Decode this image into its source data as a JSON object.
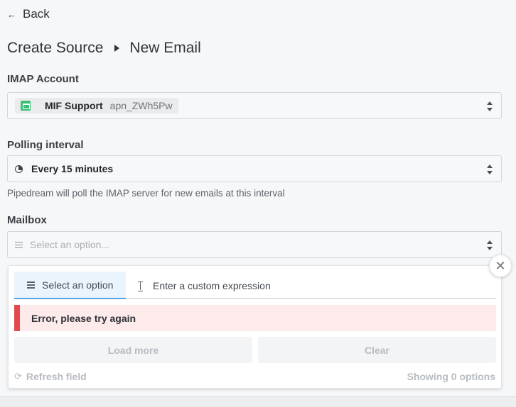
{
  "nav": {
    "back_arrow": "←",
    "back_label": "Back"
  },
  "header": {
    "crumb_1": "Create Source",
    "crumb_2": "New Email",
    "separator_icon": "caret-right-icon"
  },
  "imap": {
    "label": "IMAP Account",
    "account_icon": "email-icon",
    "account_icon_color": "#3bbf76",
    "account_name": "MIF Support",
    "account_id": "apn_ZWh5Pw"
  },
  "polling": {
    "label": "Polling interval",
    "icon": "clock-icon",
    "value": "Every 15 minutes",
    "hint": "Pipedream will poll the IMAP server for new emails at this interval"
  },
  "mailbox": {
    "label": "Mailbox",
    "icon": "list-icon",
    "placeholder": "Select an option..."
  },
  "dropdown": {
    "tabs": [
      {
        "label": "Select an option",
        "icon": "list-icon",
        "active": true
      },
      {
        "label": "Enter a custom expression",
        "icon": "text-cursor-icon",
        "active": false
      }
    ],
    "error": "Error, please try again",
    "error_color": "#e4484f",
    "load_more": "Load more",
    "clear": "Clear",
    "refresh_icon": "⟳",
    "refresh": "Refresh field",
    "showing": "Showing 0 options",
    "close_glyph": "✕",
    "accent": "#5aa3e3"
  }
}
